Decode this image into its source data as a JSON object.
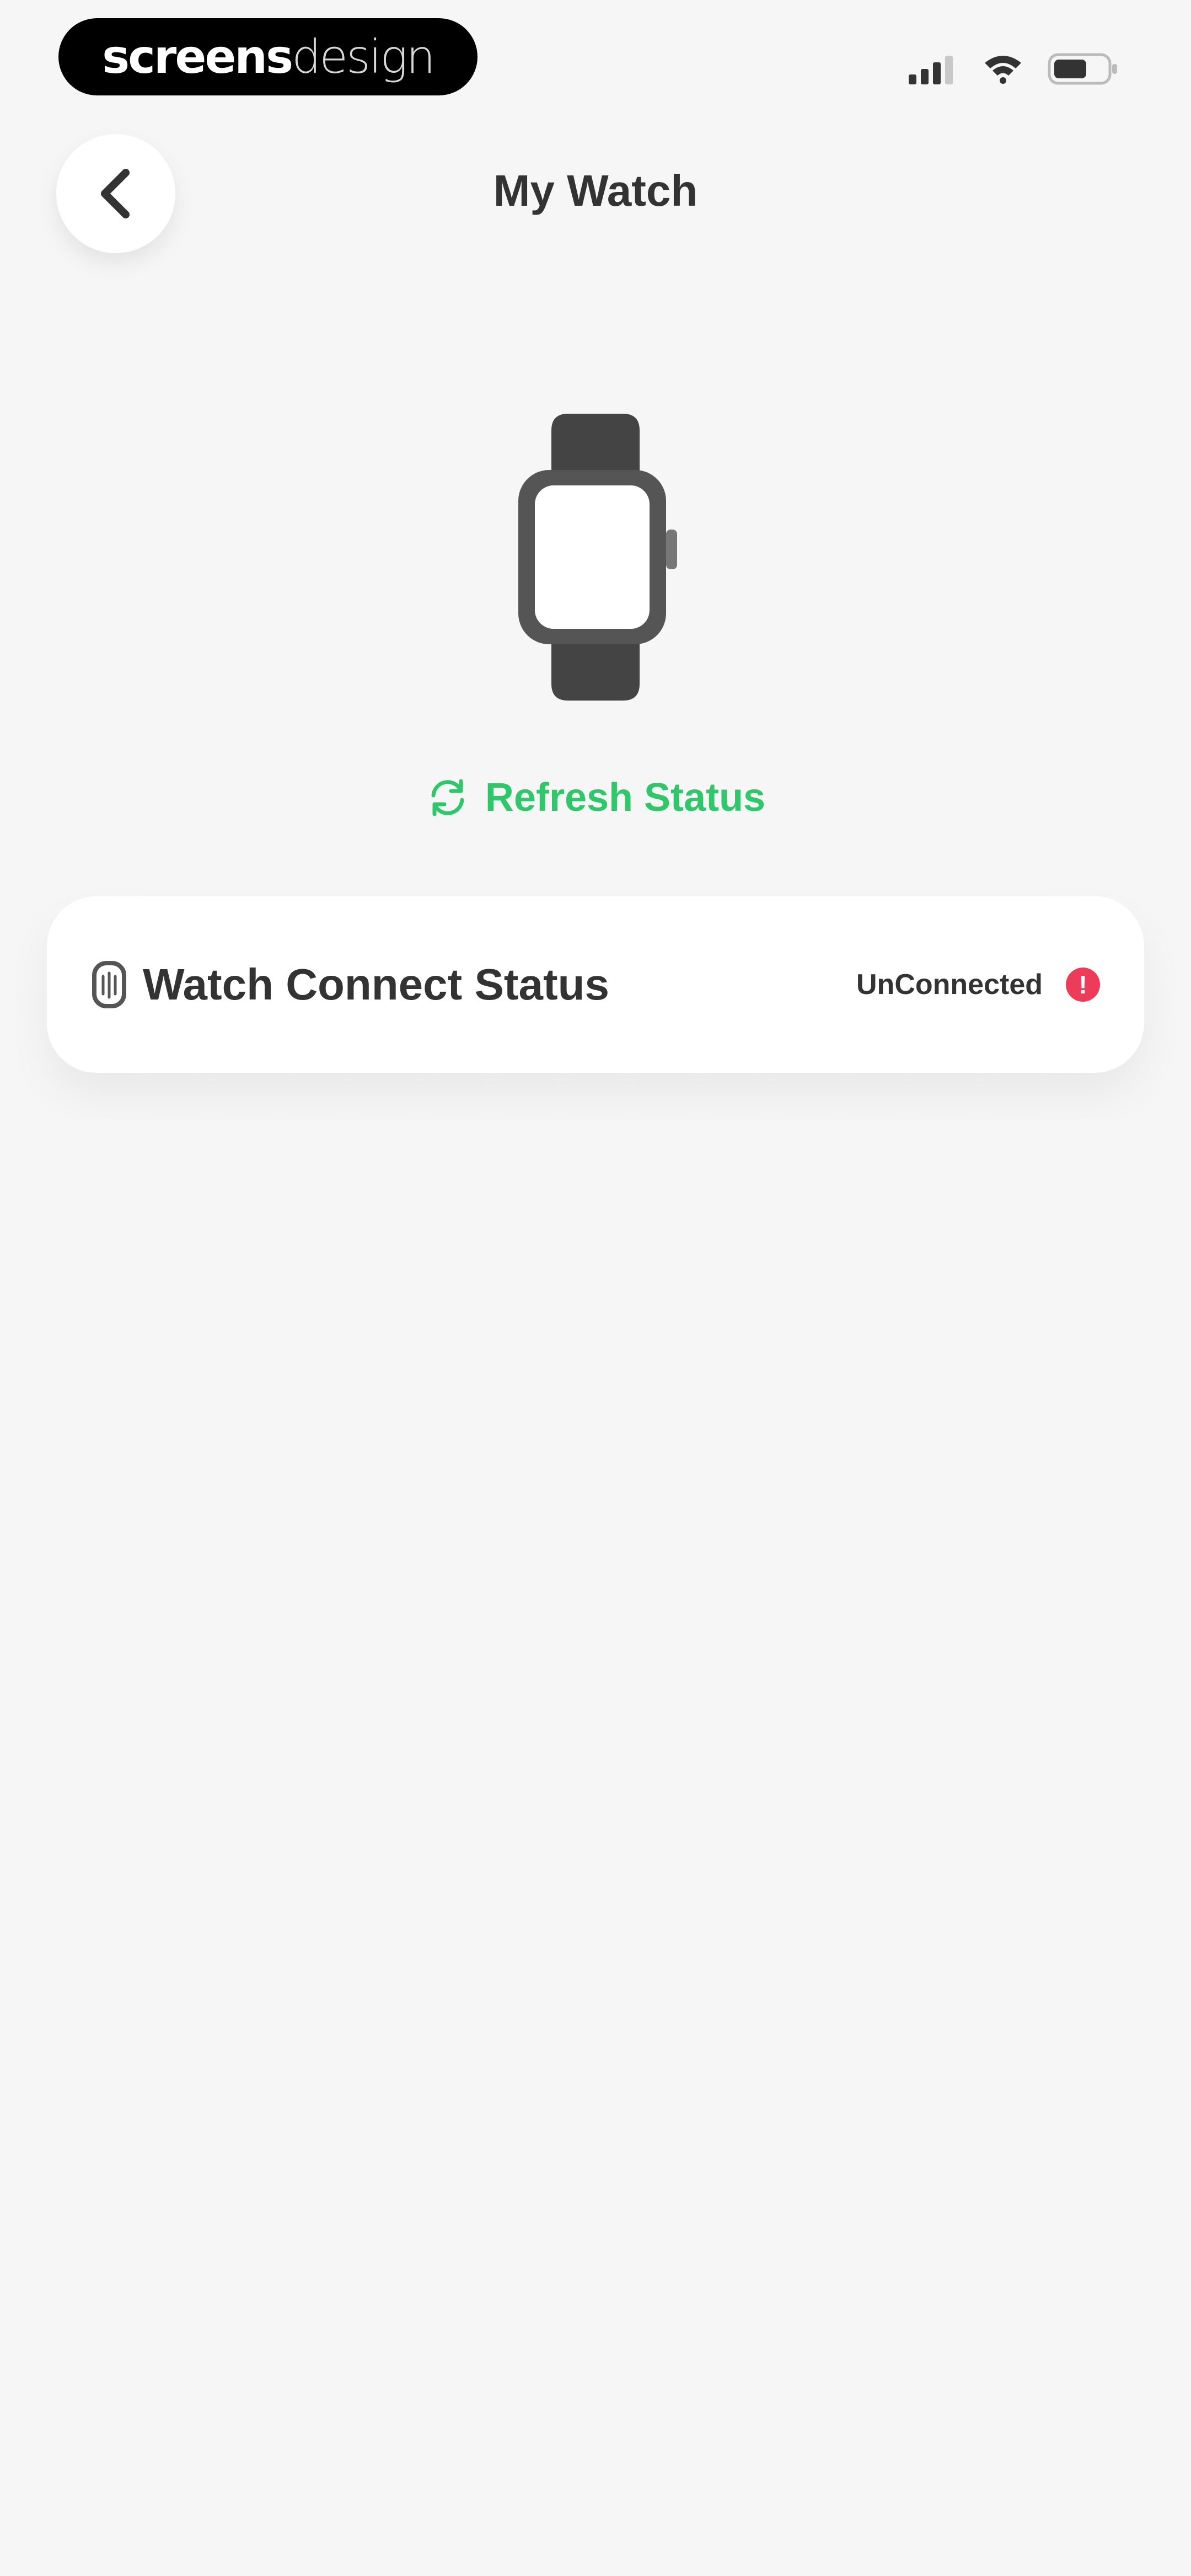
{
  "status_bar": {
    "brand_bold": "screens",
    "brand_light": "design",
    "icons": [
      "signal-icon",
      "wifi-icon",
      "battery-icon"
    ]
  },
  "header": {
    "title": "My Watch",
    "back_icon": "chevron-left-icon"
  },
  "watch": {
    "icon": "smartwatch-icon"
  },
  "refresh": {
    "label": "Refresh Status",
    "icon": "refresh-icon"
  },
  "status_card": {
    "label": "Watch Connect Status",
    "value": "UnConnected",
    "label_icon": "watch-small-icon",
    "status_icon": "alert-icon"
  },
  "colors": {
    "accent": "#2ec76a",
    "alert": "#ef3b5a",
    "icon_gray": "#555555",
    "background": "#f6f6f6"
  }
}
